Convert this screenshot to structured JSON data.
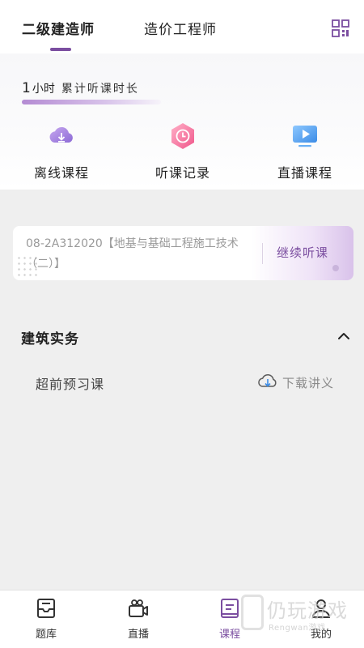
{
  "top_tabs": [
    {
      "label": "二级建造师",
      "active": true
    },
    {
      "label": "造价工程师",
      "active": false
    }
  ],
  "top_icons": {
    "grid": "qr-grid-icon"
  },
  "study": {
    "hours_value": "1",
    "hours_unit": "小时",
    "hours_label": "累计听课时长"
  },
  "quick_actions": [
    {
      "label": "离线课程",
      "icon": "cloud-download-icon"
    },
    {
      "label": "听课记录",
      "icon": "clock-history-icon"
    },
    {
      "label": "直播课程",
      "icon": "video-play-icon"
    }
  ],
  "continue_card": {
    "course_title": "08-2A312020【地基与基础工程施工技术（二）】",
    "button_label": "继续听课"
  },
  "section": {
    "title": "建筑实务",
    "lesson_label": "超前预习课",
    "download_label": "下载讲义"
  },
  "bottom_nav": [
    {
      "label": "题库",
      "icon": "tray-icon",
      "active": false
    },
    {
      "label": "直播",
      "icon": "camera-icon",
      "active": false
    },
    {
      "label": "课程",
      "icon": "book-icon",
      "active": true
    },
    {
      "label": "我的",
      "icon": "user-icon",
      "active": false
    }
  ],
  "watermark": {
    "cn": "仍玩游戏",
    "en": "Rengwan游戏"
  },
  "colors": {
    "accent": "#7b4ea0",
    "background": "#efefef",
    "card_gradient_end": "#d9c2ea"
  }
}
